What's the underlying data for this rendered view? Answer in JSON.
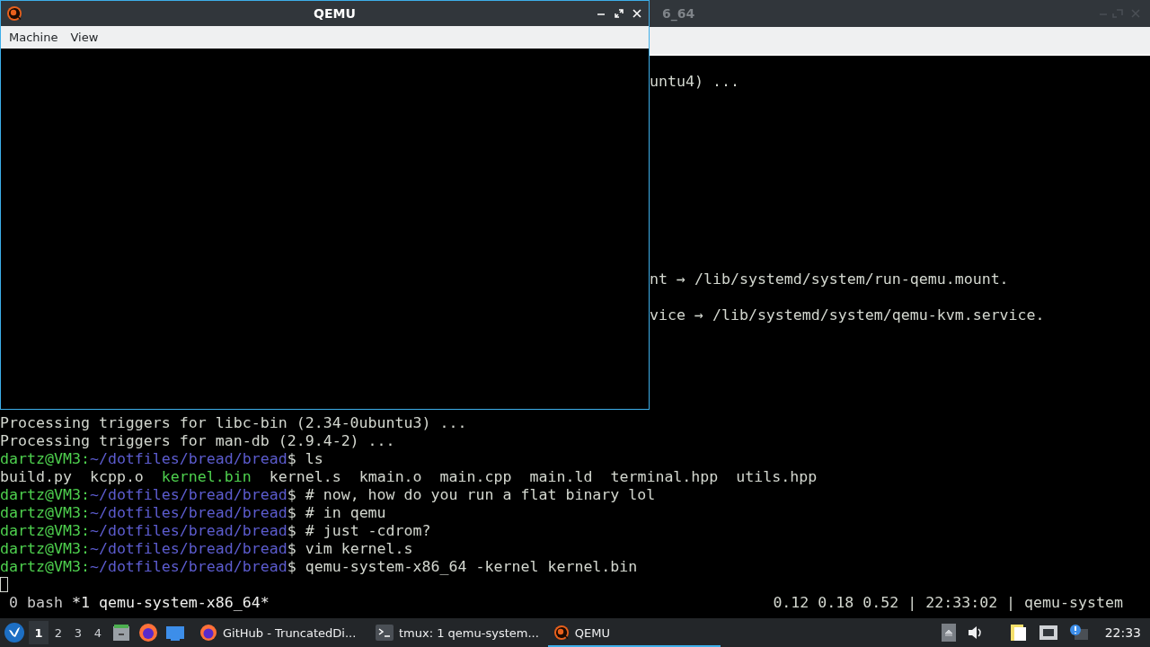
{
  "terminal_window": {
    "title": "6_64",
    "visible_fragments": [
      {
        "text": "untu4) ..."
      },
      {
        "text": "nt → /lib/systemd/system/run-qemu.mount."
      },
      {
        "text": "vice → /lib/systemd/system/qemu-kvm.service."
      }
    ],
    "lines": [
      {
        "kind": "output",
        "text": "Processing triggers for libc-bin (2.34-0ubuntu3) ..."
      },
      {
        "kind": "output",
        "text": "Processing triggers for man-db (2.9.4-2) ..."
      },
      {
        "kind": "prompt",
        "user": "dartz@VM3:",
        "path": "~/dotfiles/bread/bread",
        "command": "$ ls"
      },
      {
        "kind": "listing",
        "files": [
          {
            "name": "build.py",
            "executable": false
          },
          {
            "name": "kcpp.o",
            "executable": false
          },
          {
            "name": "kernel.bin",
            "executable": true
          },
          {
            "name": "kernel.s",
            "executable": false
          },
          {
            "name": "kmain.o",
            "executable": false
          },
          {
            "name": "main.cpp",
            "executable": false
          },
          {
            "name": "main.ld",
            "executable": false
          },
          {
            "name": "terminal.hpp",
            "executable": false
          },
          {
            "name": "utils.hpp",
            "executable": false
          }
        ]
      },
      {
        "kind": "prompt",
        "user": "dartz@VM3:",
        "path": "~/dotfiles/bread/bread",
        "command": "$ # now, how do you run a flat binary lol"
      },
      {
        "kind": "prompt",
        "user": "dartz@VM3:",
        "path": "~/dotfiles/bread/bread",
        "command": "$ # in qemu"
      },
      {
        "kind": "prompt",
        "user": "dartz@VM3:",
        "path": "~/dotfiles/bread/bread",
        "command": "$ # just -cdrom?"
      },
      {
        "kind": "prompt",
        "user": "dartz@VM3:",
        "path": "~/dotfiles/bread/bread",
        "command": "$ vim kernel.s"
      },
      {
        "kind": "prompt",
        "user": "dartz@VM3:",
        "path": "~/dotfiles/bread/bread",
        "command": "$ qemu-system-x86_64 -kernel kernel.bin"
      },
      {
        "kind": "cursor"
      }
    ],
    "tmux_status": {
      "windows": [
        {
          "label": "0 bash",
          "selected": false
        },
        {
          "label": "*1 qemu-system-x86_64*",
          "selected": true
        }
      ],
      "right": "0.12 0.18 0.52 | 22:33:02 | qemu-system"
    }
  },
  "qemu_window": {
    "title": "QEMU",
    "menu": [
      "Machine",
      "View"
    ]
  },
  "taskbar": {
    "desktops": [
      {
        "label": "1",
        "selected": true
      },
      {
        "label": "2",
        "selected": false
      },
      {
        "label": "3",
        "selected": false
      },
      {
        "label": "4",
        "selected": false
      }
    ],
    "tasks": [
      {
        "label": "GitHub - TruncatedDi...",
        "kind": "browser",
        "selected": false
      },
      {
        "label": "tmux: 1 qemu-system...",
        "kind": "terminal",
        "selected": false
      },
      {
        "label": "QEMU",
        "kind": "qemu",
        "selected": true
      }
    ],
    "clock": "22:33"
  }
}
